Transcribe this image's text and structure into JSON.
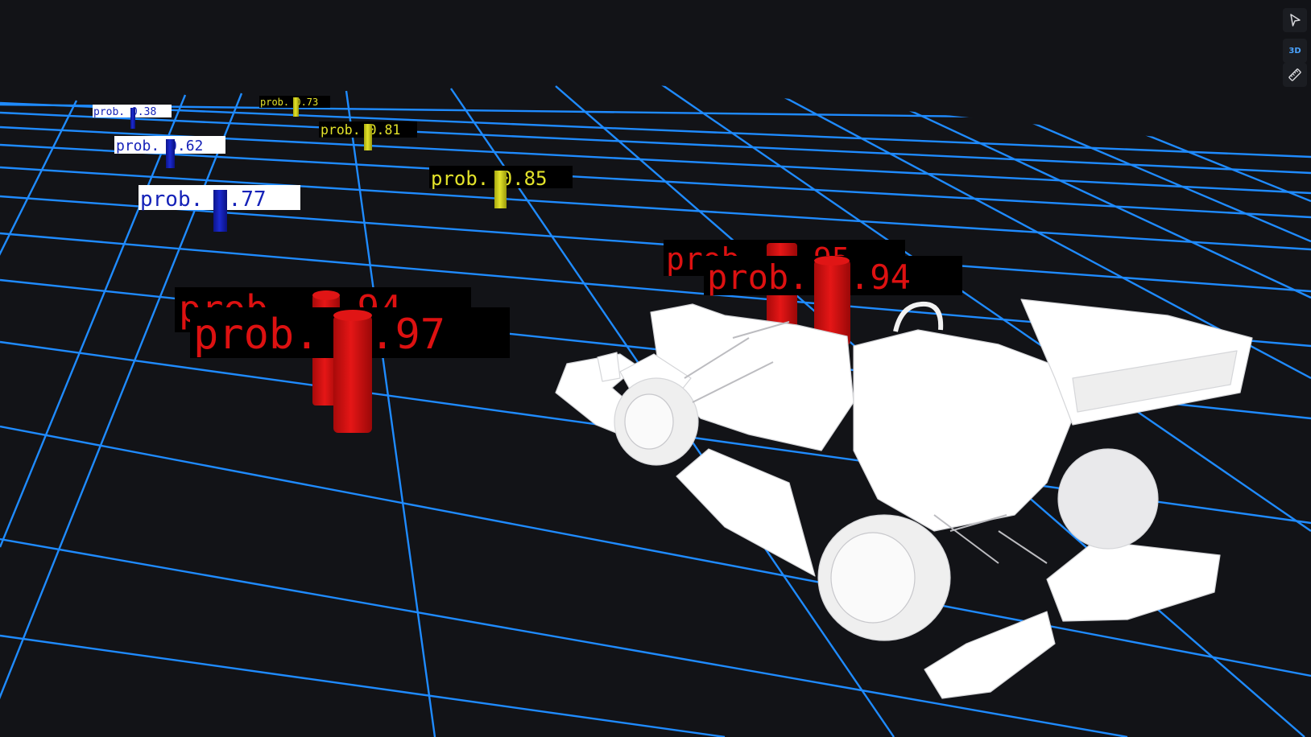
{
  "viewer": {
    "toolbar": {
      "view_mode_label": "3D",
      "select_tool_icon": "cursor-arrow-icon",
      "measure_tool_icon": "ruler-icon"
    },
    "colors": {
      "background": "#121317",
      "grid": "#1f8bff",
      "vehicle": "#ffffff",
      "class_red": "#dd1111",
      "class_yellow": "#d8d81a",
      "class_blue": "#1522b8",
      "toolbar_accent": "#4aa3ff"
    },
    "detections": [
      {
        "id": "d1",
        "label": "prob. 0.38",
        "class_color": "blue"
      },
      {
        "id": "d2",
        "label": "prob. 0.62",
        "class_color": "blue"
      },
      {
        "id": "d3",
        "label": "prob. 0.77",
        "class_color": "blue"
      },
      {
        "id": "d4",
        "label": "prob. 0.73",
        "class_color": "yellow"
      },
      {
        "id": "d5",
        "label": "prob. 0.81",
        "class_color": "yellow"
      },
      {
        "id": "d6",
        "label": "prob. 0.85",
        "class_color": "yellow"
      },
      {
        "id": "d7",
        "label": "prob. 0.94",
        "class_color": "red"
      },
      {
        "id": "d8",
        "label": "prob. 0.97",
        "class_color": "red"
      },
      {
        "id": "d9",
        "label": "prob. 0.95",
        "class_color": "red"
      },
      {
        "id": "d10",
        "label": "prob. 0.94",
        "class_color": "red"
      }
    ],
    "vehicle": {
      "name": "race-car-model"
    }
  }
}
